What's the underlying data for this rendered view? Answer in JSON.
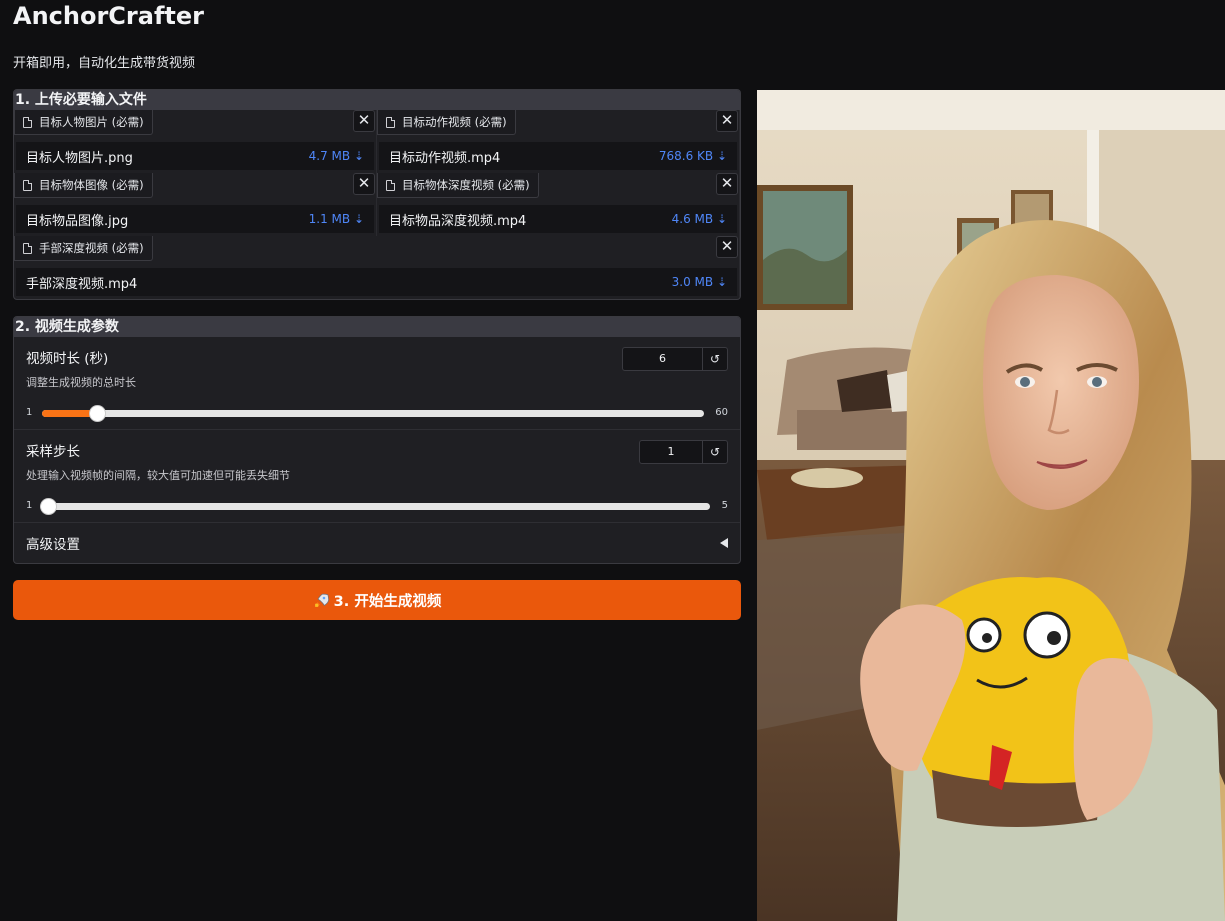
{
  "app": {
    "title": "AnchorCrafter",
    "subtitle": "开箱即用，自动化生成带货视频"
  },
  "upload": {
    "heading": "1. 上传必要输入文件",
    "files": [
      {
        "label": "目标人物图片 (必需)",
        "name": "目标人物图片.png",
        "size": "4.7 MB ⇣"
      },
      {
        "label": "目标动作视频 (必需)",
        "name": "目标动作视频.mp4",
        "size": "768.6 KB ⇣"
      },
      {
        "label": "目标物体图像 (必需)",
        "name": "目标物品图像.jpg",
        "size": "1.1 MB ⇣"
      },
      {
        "label": "目标物体深度视频 (必需)",
        "name": "目标物品深度视频.mp4",
        "size": "4.6 MB ⇣"
      },
      {
        "label": "手部深度视频 (必需)",
        "name": "手部深度视频.mp4",
        "size": "3.0 MB ⇣"
      }
    ],
    "close_glyph": "✕"
  },
  "params": {
    "heading": "2. 视频生成参数",
    "duration": {
      "title": "视频时长 (秒)",
      "desc": "调整生成视频的总时长",
      "value": "6",
      "min": "1",
      "max": "60",
      "fraction": 0.085
    },
    "stride": {
      "title": "采样步长",
      "desc": "处理输入视频帧的间隔，较大值可加速但可能丢失细节",
      "value": "1",
      "min": "1",
      "max": "5",
      "fraction": 0.0
    },
    "reset_glyph": "↺",
    "advanced": "高级设置"
  },
  "generate": {
    "icon": "rocket-icon",
    "label": "3. 开始生成视频",
    "color": "#ea580c"
  },
  "preview": {
    "kind": "generated-video-frame"
  }
}
